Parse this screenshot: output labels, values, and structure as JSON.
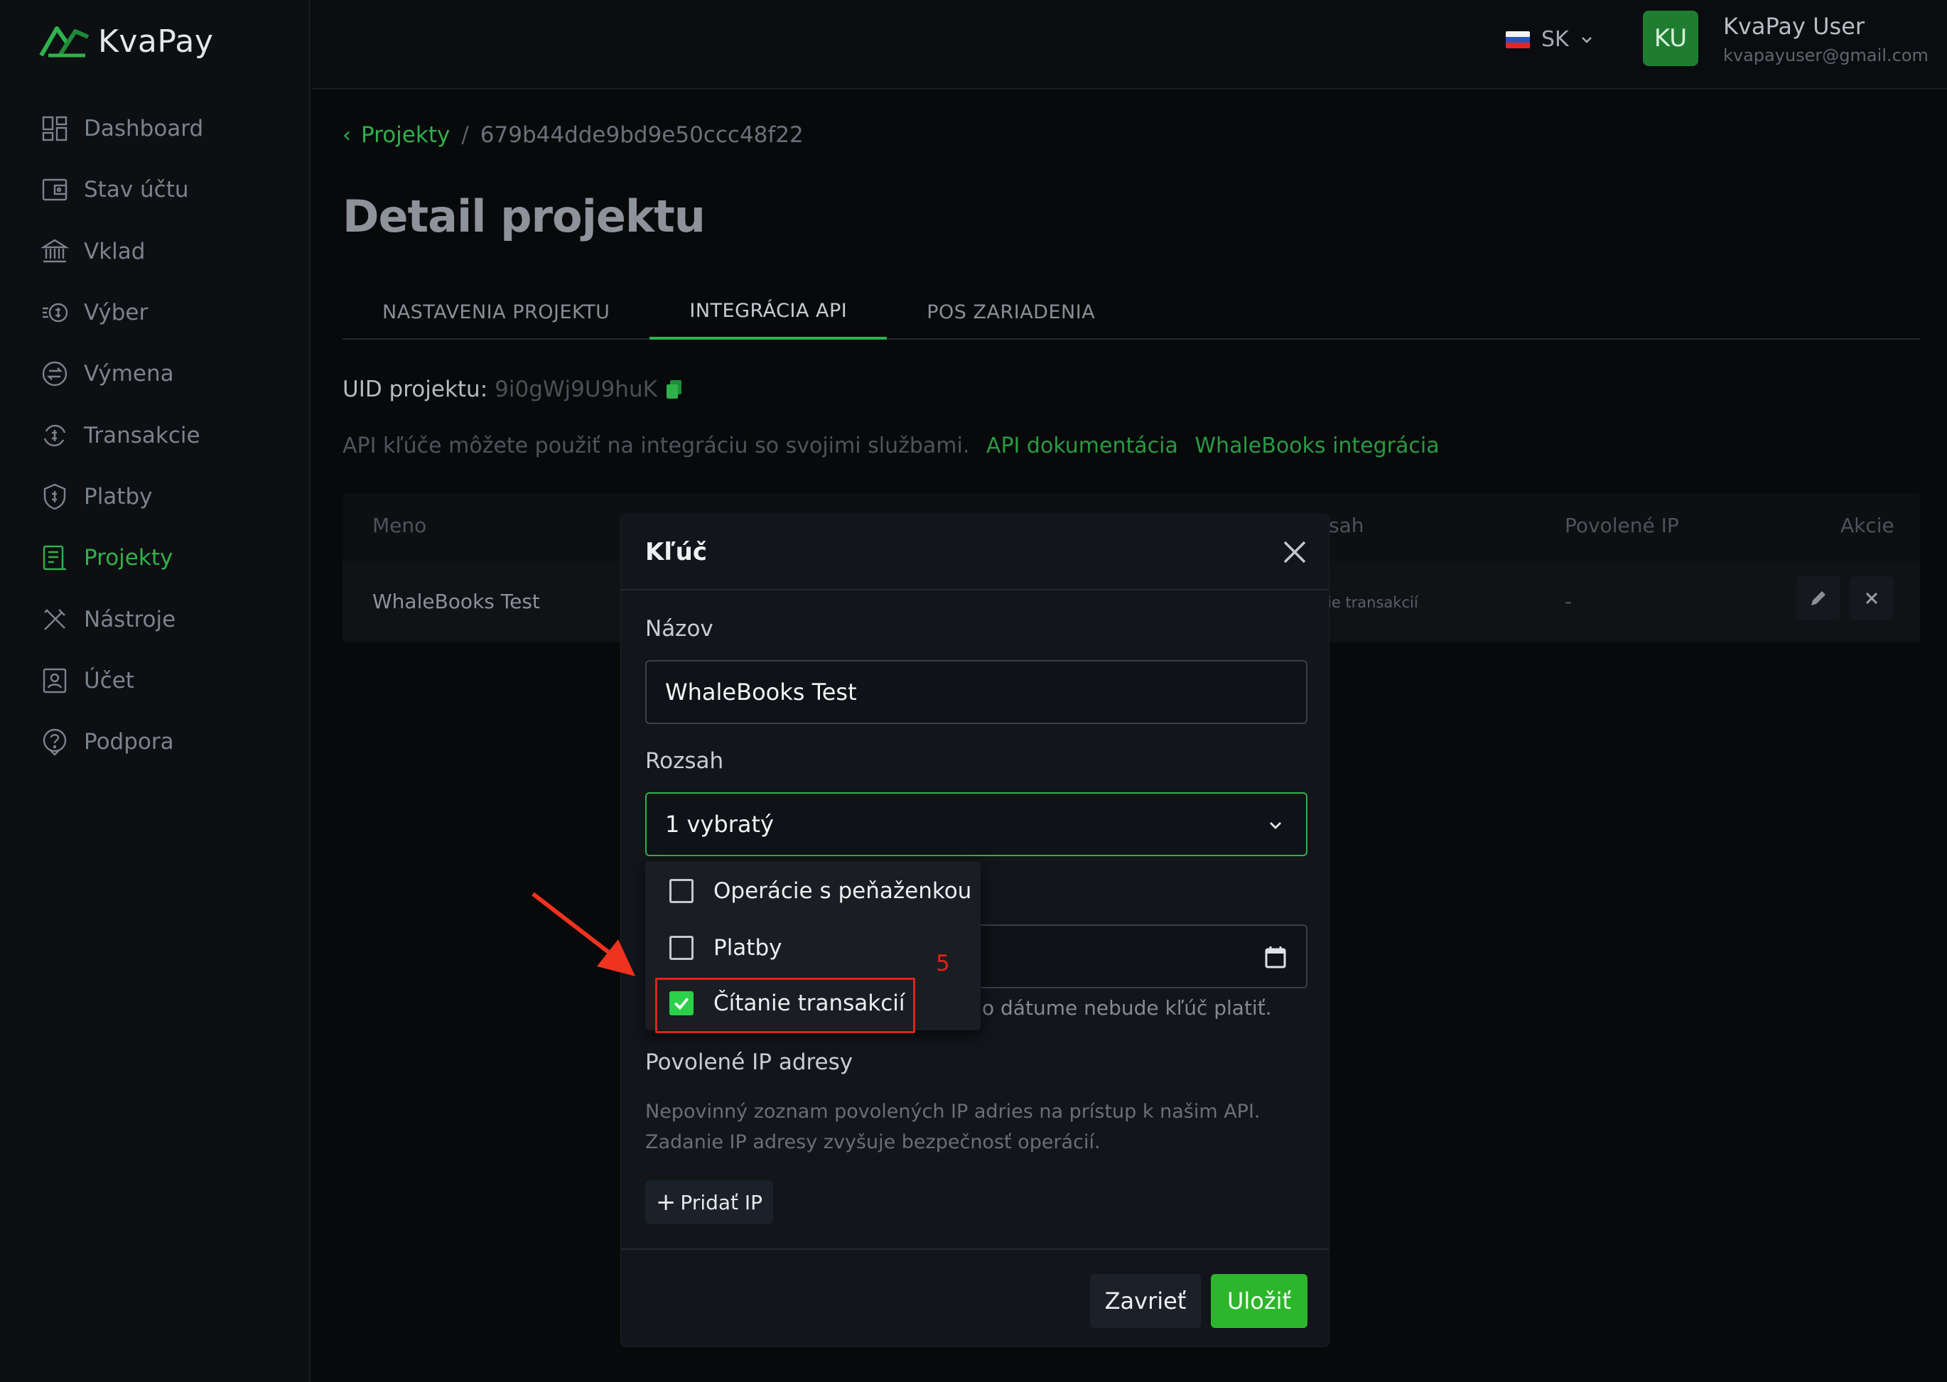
{
  "app": {
    "name": "KvaPay"
  },
  "sidebar": {
    "items": [
      {
        "label": "Dashboard",
        "icon": "dashboard-icon"
      },
      {
        "label": "Stav účtu",
        "icon": "wallet-icon"
      },
      {
        "label": "Vklad",
        "icon": "bank-icon"
      },
      {
        "label": "Výber",
        "icon": "withdraw-icon"
      },
      {
        "label": "Výmena",
        "icon": "exchange-icon"
      },
      {
        "label": "Transakcie",
        "icon": "transactions-icon"
      },
      {
        "label": "Platby",
        "icon": "shield-dollar-icon"
      },
      {
        "label": "Projekty",
        "icon": "document-icon",
        "active": true
      },
      {
        "label": "Nástroje",
        "icon": "tools-icon"
      },
      {
        "label": "Účet",
        "icon": "account-icon"
      },
      {
        "label": "Podpora",
        "icon": "help-icon"
      }
    ]
  },
  "header": {
    "language": "SK",
    "user": {
      "initials": "KU",
      "name": "KvaPay User",
      "email": "kvapayuser@gmail.com"
    }
  },
  "breadcrumb": {
    "parent": "Projekty",
    "current": "679b44dde9bd9e50ccc48f22"
  },
  "page": {
    "title": "Detail projektu",
    "tabs": [
      "NASTAVENIA PROJEKTU",
      "INTEGRÁCIA API",
      "POS ZARIADENIA"
    ],
    "active_tab": "INTEGRÁCIA API",
    "uid_label": "UID projektu:",
    "uid_value": "9i0gWj9U9huK",
    "api_note": "API kľúče môžete použiť na integráciu so svojimi službami.",
    "api_doc_link": "API dokumentácia",
    "whalebooks_link": "WhaleBooks integrácia"
  },
  "table": {
    "columns": {
      "name": "Meno",
      "scope": "sah",
      "ips": "Povolené IP",
      "actions": "Akcie"
    },
    "rows": [
      {
        "name": "WhaleBooks Test",
        "scope": "ie transakcií",
        "ips": "-"
      }
    ]
  },
  "modal": {
    "title": "Kľúč",
    "name_label": "Názov",
    "name_value": "WhaleBooks Test",
    "scope_label": "Rozsah",
    "scope_value": "1 vybratý",
    "date_hint": "o dátume nebude kľúč platiť.",
    "ip_label": "Povolené IP adresy",
    "ip_help_1": "Nepovinný zoznam povolených IP adries na prístup k našim API.",
    "ip_help_2": "Zadanie IP adresy zvyšuje bezpečnosť operácií.",
    "add_ip": "Pridať IP",
    "close_button": "Zavrieť",
    "save_button": "Uložiť"
  },
  "dropdown": {
    "options": [
      {
        "label": "Operácie s peňaženkou",
        "checked": false
      },
      {
        "label": "Platby",
        "checked": false
      },
      {
        "label": "Čítanie transakcií",
        "checked": true
      }
    ]
  },
  "annotation": {
    "step": "5",
    "color": "#e0231c"
  },
  "colors": {
    "accent": "#2fb14c",
    "save": "#2db62c",
    "background": "#08090b"
  }
}
